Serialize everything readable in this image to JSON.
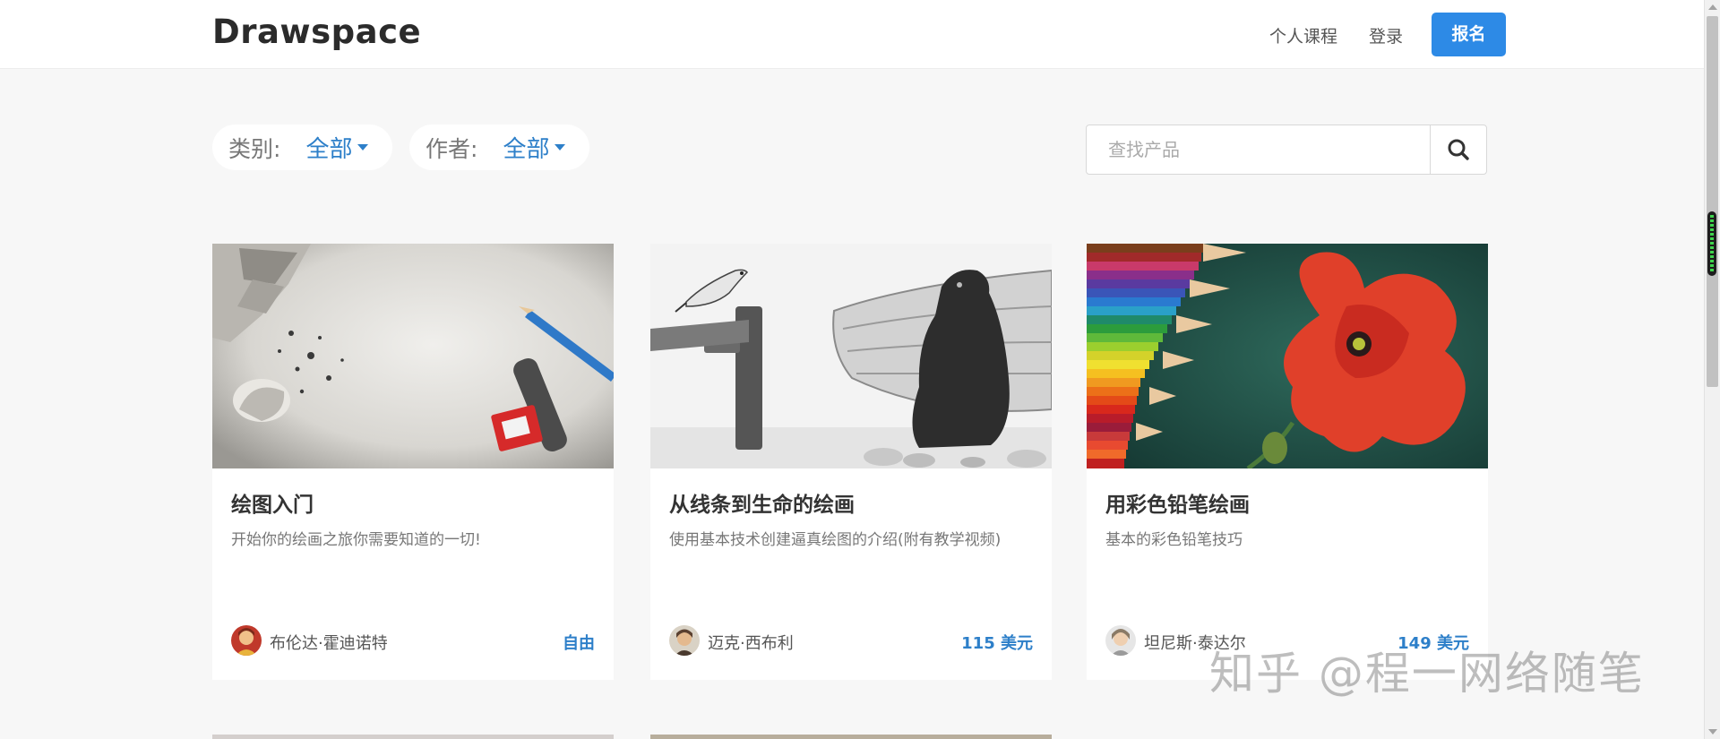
{
  "header": {
    "logo": "Drawspace",
    "nav": {
      "my_courses": "个人课程",
      "login": "登录"
    },
    "signup": "报名"
  },
  "filters": {
    "category": {
      "label": "类别:",
      "value": "全部"
    },
    "author": {
      "label": "作者:",
      "value": "全部"
    }
  },
  "search": {
    "placeholder": "查找产品",
    "value": ""
  },
  "courses": [
    {
      "title": "绘图入门",
      "description": "开始你的绘画之旅你需要知道的一切!",
      "author": "布伦达·霍迪诺特",
      "price": "自由"
    },
    {
      "title": "从线条到生命的绘画",
      "description": "使用基本技术创建逼真绘图的介绍(附有教学视频)",
      "author": "迈克·西布利",
      "price": "115 美元"
    },
    {
      "title": "用彩色铅笔绘画",
      "description": "基本的彩色铅笔技巧",
      "author": "坦尼斯·泰达尔",
      "price": "149 美元"
    }
  ],
  "watermark": "知乎 @程一网络随笔",
  "colors": {
    "accent": "#2d8ae6",
    "link": "#2d7fc9",
    "background": "#f7f7f7"
  },
  "icons": {
    "search": "search-icon",
    "caret": "caret-down-icon"
  }
}
